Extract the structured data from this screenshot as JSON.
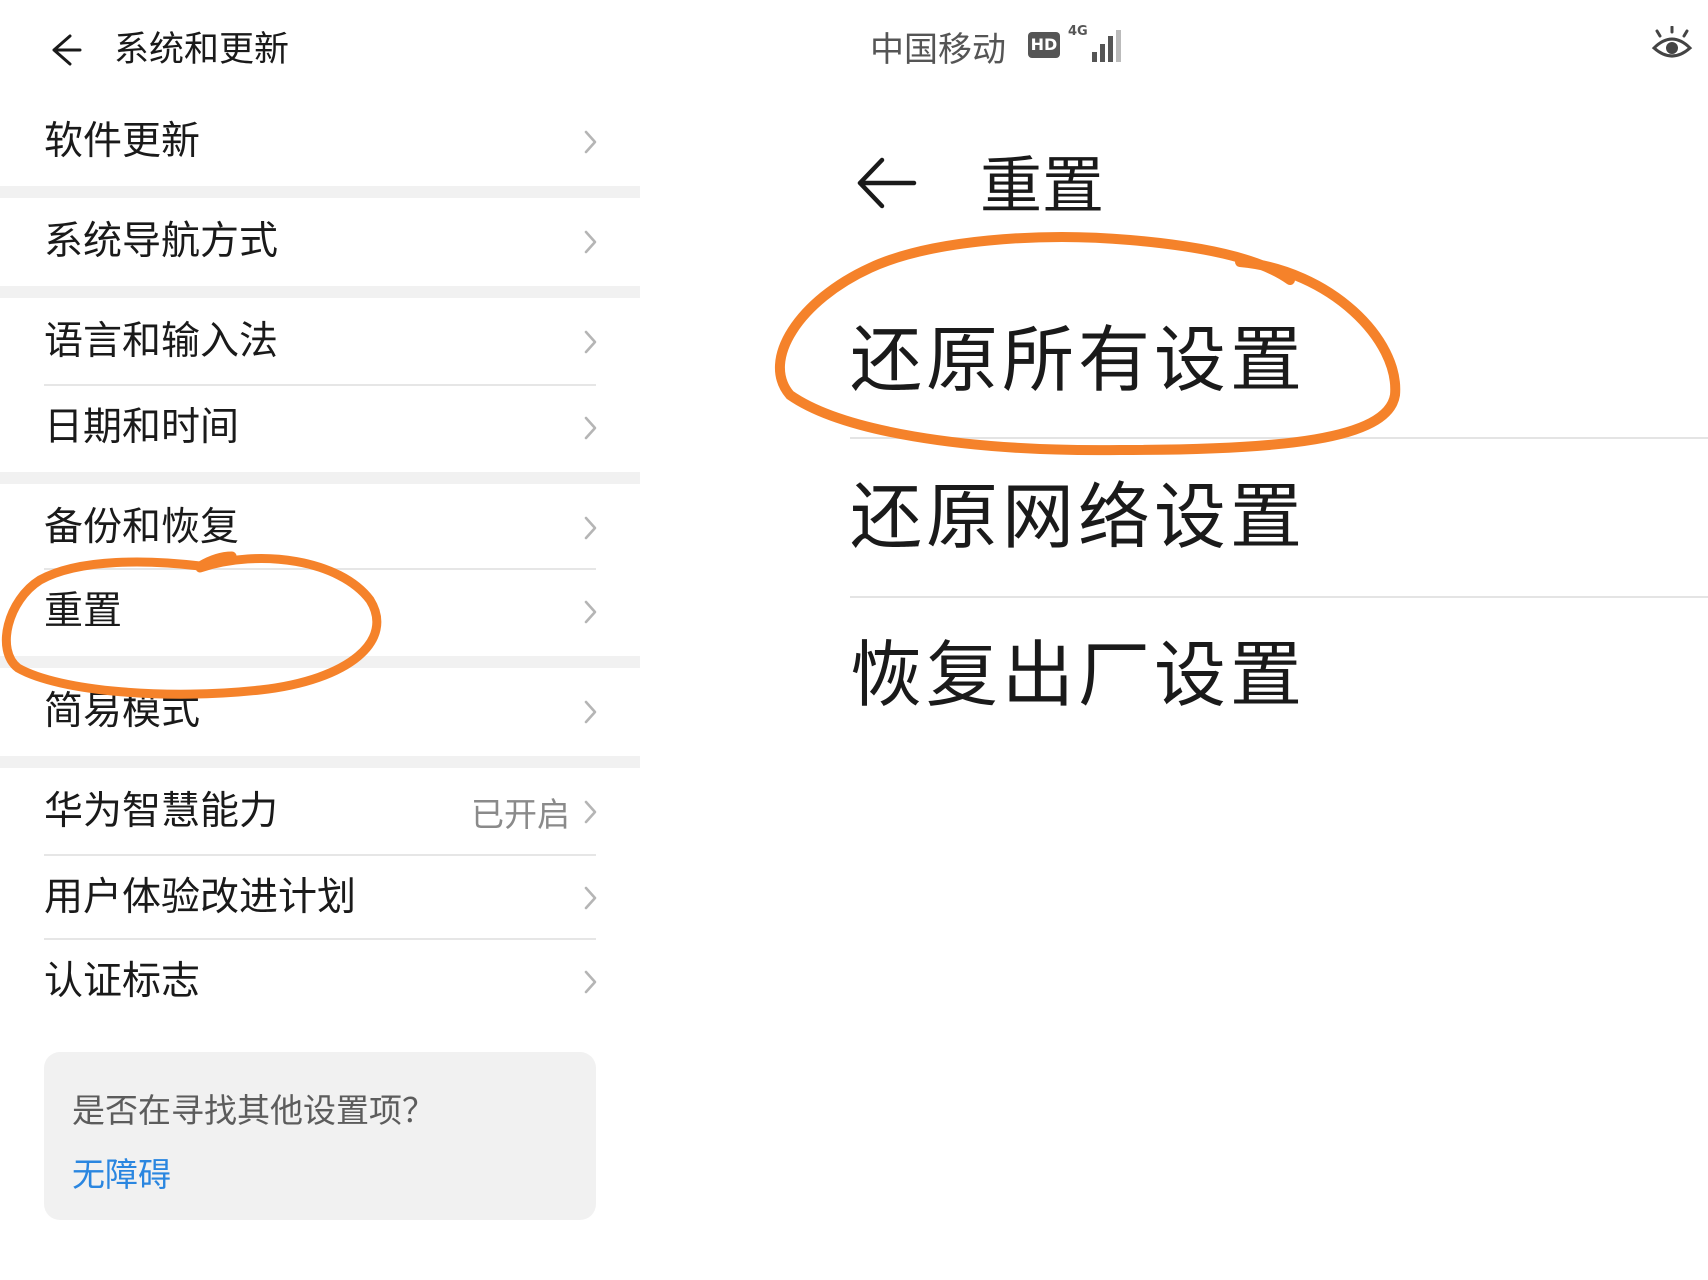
{
  "left_panel": {
    "header": {
      "title": "系统和更新"
    },
    "items": [
      {
        "label": "软件更新",
        "value": ""
      },
      {
        "label": "系统导航方式",
        "value": ""
      },
      {
        "label": "语言和输入法",
        "value": ""
      },
      {
        "label": "日期和时间",
        "value": ""
      },
      {
        "label": "备份和恢复",
        "value": ""
      },
      {
        "label": "重置",
        "value": ""
      },
      {
        "label": "简易模式",
        "value": ""
      },
      {
        "label": "华为智慧能力",
        "value": "已开启"
      },
      {
        "label": "用户体验改进计划",
        "value": ""
      },
      {
        "label": "认证标志",
        "value": ""
      }
    ],
    "search_card": {
      "question": "是否在寻找其他设置项？",
      "link": "无障碍"
    }
  },
  "right_panel": {
    "status_bar": {
      "carrier": "中国移动",
      "hd_badge": "HD",
      "network": "4G"
    },
    "header": {
      "title": "重置"
    },
    "items": [
      {
        "label": "还原所有设置"
      },
      {
        "label": "还原网络设置"
      },
      {
        "label": "恢复出厂设置"
      }
    ]
  },
  "colors": {
    "annotation": "#f5822a",
    "link": "#2a86e0",
    "secondary_text": "#8a8a8a",
    "section_gap": "#f1f1f1"
  }
}
